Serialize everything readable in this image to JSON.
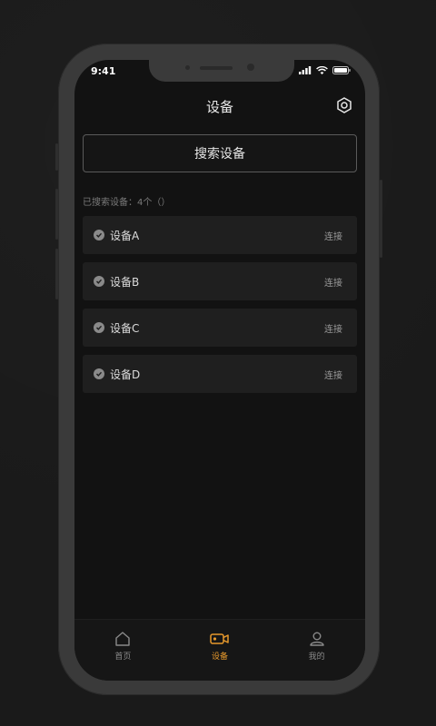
{
  "status": {
    "time": "9:41"
  },
  "header": {
    "title": "设备"
  },
  "search": {
    "button_label": "搜索设备"
  },
  "found": {
    "label": "已搜索设备：4个（）"
  },
  "devices": [
    {
      "name": "设备A",
      "action": "连接"
    },
    {
      "name": "设备B",
      "action": "连接"
    },
    {
      "name": "设备C",
      "action": "连接"
    },
    {
      "name": "设备D",
      "action": "连接"
    }
  ],
  "tabs": [
    {
      "label": "首页",
      "icon": "home-icon",
      "active": false
    },
    {
      "label": "设备",
      "icon": "camera-icon",
      "active": true
    },
    {
      "label": "我的",
      "icon": "user-icon",
      "active": false
    }
  ],
  "colors": {
    "accent": "#e7992c",
    "background": "#121212",
    "row": "#1f1f1f"
  }
}
